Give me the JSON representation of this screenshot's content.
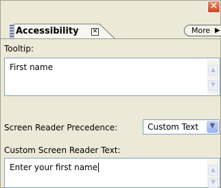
{
  "window": {
    "close_icon": "close-icon"
  },
  "panel": {
    "tab_label": "Accessibility",
    "tab_close_icon": "close-small-icon",
    "more_label": "More"
  },
  "tooltip": {
    "label": "Tooltip:",
    "value": "First name"
  },
  "precedence": {
    "label": "Screen Reader Precedence:",
    "selected": "Custom Text"
  },
  "custom_text": {
    "label": "Custom Screen Reader Text:",
    "value": "Enter your first name"
  }
}
